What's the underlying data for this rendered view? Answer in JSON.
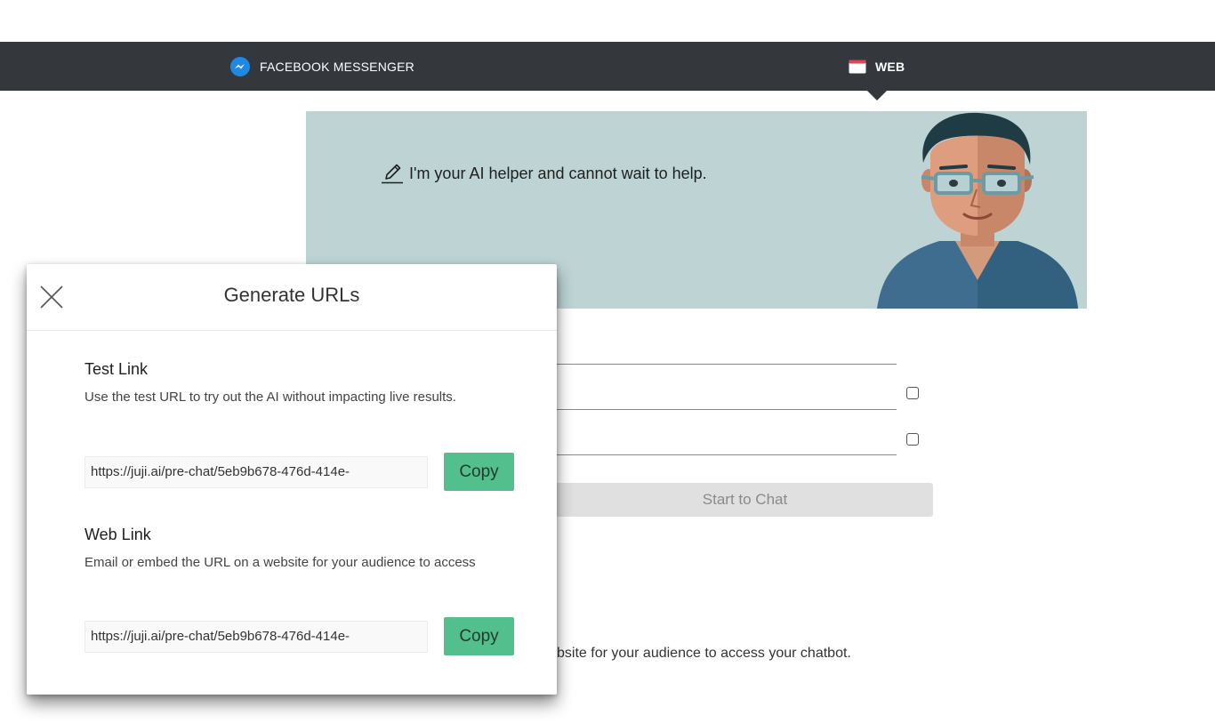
{
  "channels": {
    "messenger": {
      "label": "FACEBOOK MESSENGER",
      "icon": "messenger-icon",
      "color": "#1e88e5"
    },
    "web": {
      "label": "WEB",
      "icon": "browser-window-icon",
      "active": true
    }
  },
  "hero": {
    "text": "I'm your AI helper and cannot wait to help.",
    "background": "#bdd3d4"
  },
  "form": {
    "start_button": "Start to Chat"
  },
  "bottom_text": "bsite for your audience to access your chatbot.",
  "modal": {
    "title": "Generate URLs",
    "test_link": {
      "title": "Test Link",
      "desc": "Use the test URL to try out the AI without impacting live results.",
      "url": "https://juji.ai/pre-chat/5eb9b678-476d-414e-",
      "copy": "Copy"
    },
    "web_link": {
      "title": "Web Link",
      "desc": "Email or embed the URL on a website for your audience to access",
      "url": "https://juji.ai/pre-chat/5eb9b678-476d-414e-",
      "copy": "Copy"
    },
    "accent": "#52bf8d"
  }
}
